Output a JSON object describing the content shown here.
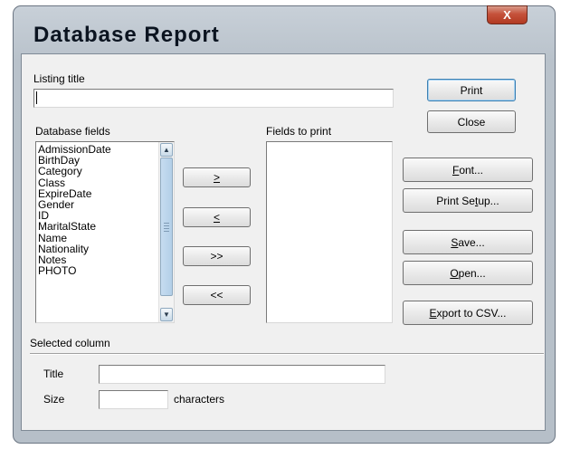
{
  "window": {
    "title": "Database Report",
    "close_symbol": "X"
  },
  "listing_title": {
    "label": "Listing title",
    "value": ""
  },
  "database_fields": {
    "label": "Database fields",
    "items": [
      "AdmissionDate",
      "BirthDay",
      "Category",
      "Class",
      "ExpireDate",
      "Gender",
      "ID",
      "MaritalState",
      "Name",
      "Nationality",
      "Notes",
      "PHOTO"
    ]
  },
  "fields_to_print": {
    "label": "Fields to print",
    "items": []
  },
  "move_buttons": {
    "add": ">",
    "remove": "<",
    "add_all": ">>",
    "remove_all": "<<"
  },
  "buttons": {
    "print": "Print",
    "close": "Close",
    "font": {
      "pre": "",
      "key": "F",
      "post": "ont..."
    },
    "print_setup": {
      "pre": "Print Se",
      "key": "t",
      "post": "up..."
    },
    "save": {
      "pre": "",
      "key": "S",
      "post": "ave..."
    },
    "open": {
      "pre": "",
      "key": "O",
      "post": "pen..."
    },
    "export_csv": {
      "pre": "",
      "key": "E",
      "post": "xport to CSV..."
    }
  },
  "selected_column": {
    "label": "Selected column",
    "title_label": "Title",
    "title_value": "",
    "size_label": "Size",
    "size_value": "",
    "size_unit": "characters"
  },
  "scroll_arrows": {
    "up": "▲",
    "down": "▼"
  }
}
